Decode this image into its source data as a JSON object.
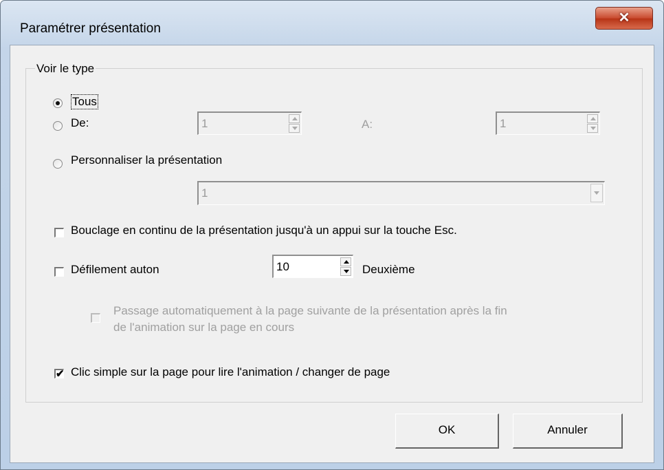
{
  "window": {
    "title": "Paramétrer présentation",
    "close_glyph": "✕"
  },
  "group": {
    "label": "Voir le type"
  },
  "radios": {
    "all": {
      "label": "Tous",
      "checked": true
    },
    "range": {
      "label": "De:",
      "checked": false
    },
    "custom": {
      "label": "Personnaliser la présentation",
      "checked": false
    }
  },
  "range": {
    "from_value": "1",
    "to_label": "A:",
    "to_value": "1"
  },
  "custom_select": {
    "value": "1"
  },
  "options": {
    "loop_label": "Bouclage en continu de la présentation jusqu'à un appui sur la touche Esc.",
    "loop_checked": false,
    "auto_label": "Défilement auton",
    "auto_checked": false,
    "auto_value": "10",
    "auto_unit": "Deuxième",
    "after_anim_line1": "Passage automatiquement à la page suivante de la présentation après la fin",
    "after_anim_line2": "de l'animation sur la page en cours",
    "after_anim_checked": false,
    "click_label": "Clic simple sur la page pour lire l'animation / changer de page",
    "click_checked": true,
    "check_glyph": "✔"
  },
  "buttons": {
    "ok": "OK",
    "cancel": "Annuler"
  },
  "colors": {
    "close_red": "#c94a2e",
    "dialog_bg": "#f0f0f0",
    "frame": "#c4d5e9"
  }
}
